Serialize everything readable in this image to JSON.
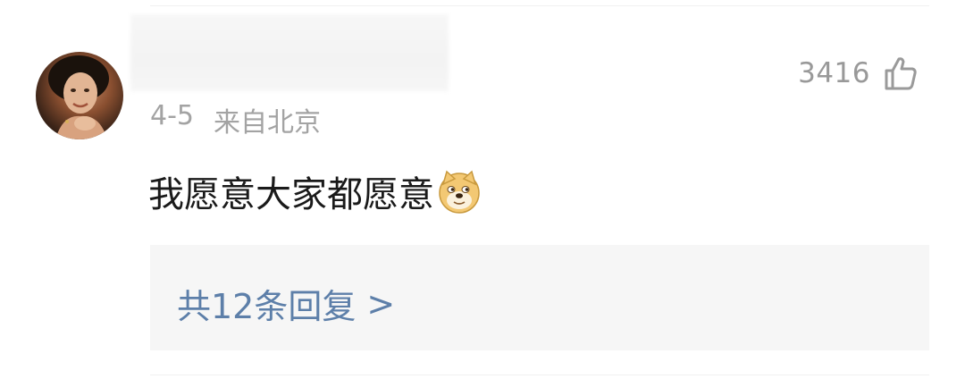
{
  "comment": {
    "avatar": "avatar-photo",
    "like_count": "3416",
    "like_icon": "thumbs-up-outline-icon",
    "date": "4-5",
    "location": "来自北京",
    "text": "我愿意大家都愿意",
    "emoji": "doge-emoji-icon",
    "replies_label": "共12条回复",
    "replies_chevron": ">"
  },
  "colors": {
    "text": "#1a1a1a",
    "meta": "#a3a3a3",
    "link": "#5d7fa9",
    "panel": "#f6f6f6"
  }
}
